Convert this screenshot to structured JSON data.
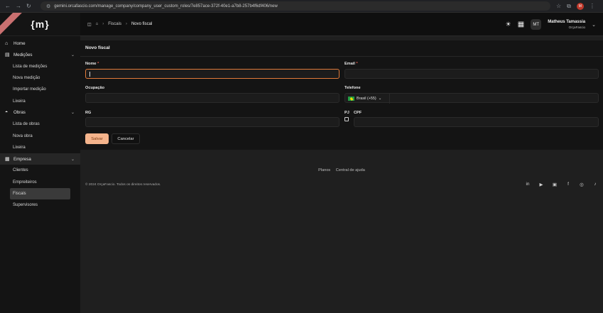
{
  "browser": {
    "url": "gemini.orcafascio.com/manage_company/company_user_custom_roles/7e857ace-372f-40e1-a7b8-257b4f6df406/new",
    "profile_initials": "M"
  },
  "sidebar": {
    "logo": "{m}",
    "ribbon": "",
    "items": [
      {
        "label": "Home",
        "icon": "home-icon"
      },
      {
        "label": "Medições",
        "icon": "clipboard-icon"
      },
      {
        "label": "Lista de medições"
      },
      {
        "label": "Nova medição"
      },
      {
        "label": "Importar medição"
      },
      {
        "label": "Lixeira"
      },
      {
        "label": "Obras",
        "icon": "helmet-icon"
      },
      {
        "label": "Lista de obras"
      },
      {
        "label": "Nova obra"
      },
      {
        "label": "Lixeira"
      },
      {
        "label": "Empresa",
        "icon": "building-icon"
      },
      {
        "label": "Clientes"
      },
      {
        "label": "Empreiteiros"
      },
      {
        "label": "Fiscais"
      },
      {
        "label": "Supervisores"
      }
    ]
  },
  "header": {
    "breadcrumb": [
      "Fiscais",
      "Novo fiscal"
    ],
    "user_initials": "MT",
    "user_name": "Matheus Tamassia",
    "company": "OrçaFascio"
  },
  "form": {
    "title": "Novo fiscal",
    "nome_label": "Nome",
    "email_label": "Email",
    "ocupacao_label": "Ocupação",
    "telefone_label": "Telefone",
    "rg_label": "RG",
    "pj_label": "PJ",
    "cpf_label": "CPF",
    "required_mark": "*",
    "country": "Brasil (+55)",
    "save": "Salvar",
    "cancel": "Cancelar"
  },
  "footer": {
    "links": [
      "Planos",
      "Central de ajuda"
    ],
    "copyright": "© 2024 OrçaFascio. Todos os direitos reservados.",
    "socials": [
      "linkedin-icon",
      "play-store-icon",
      "youtube-icon",
      "facebook-icon",
      "instagram-icon",
      "tiktok-icon"
    ]
  },
  "colors": {
    "accent": "#f5b48c",
    "focus_border": "#e07a3a",
    "required": "#e05a4f"
  }
}
